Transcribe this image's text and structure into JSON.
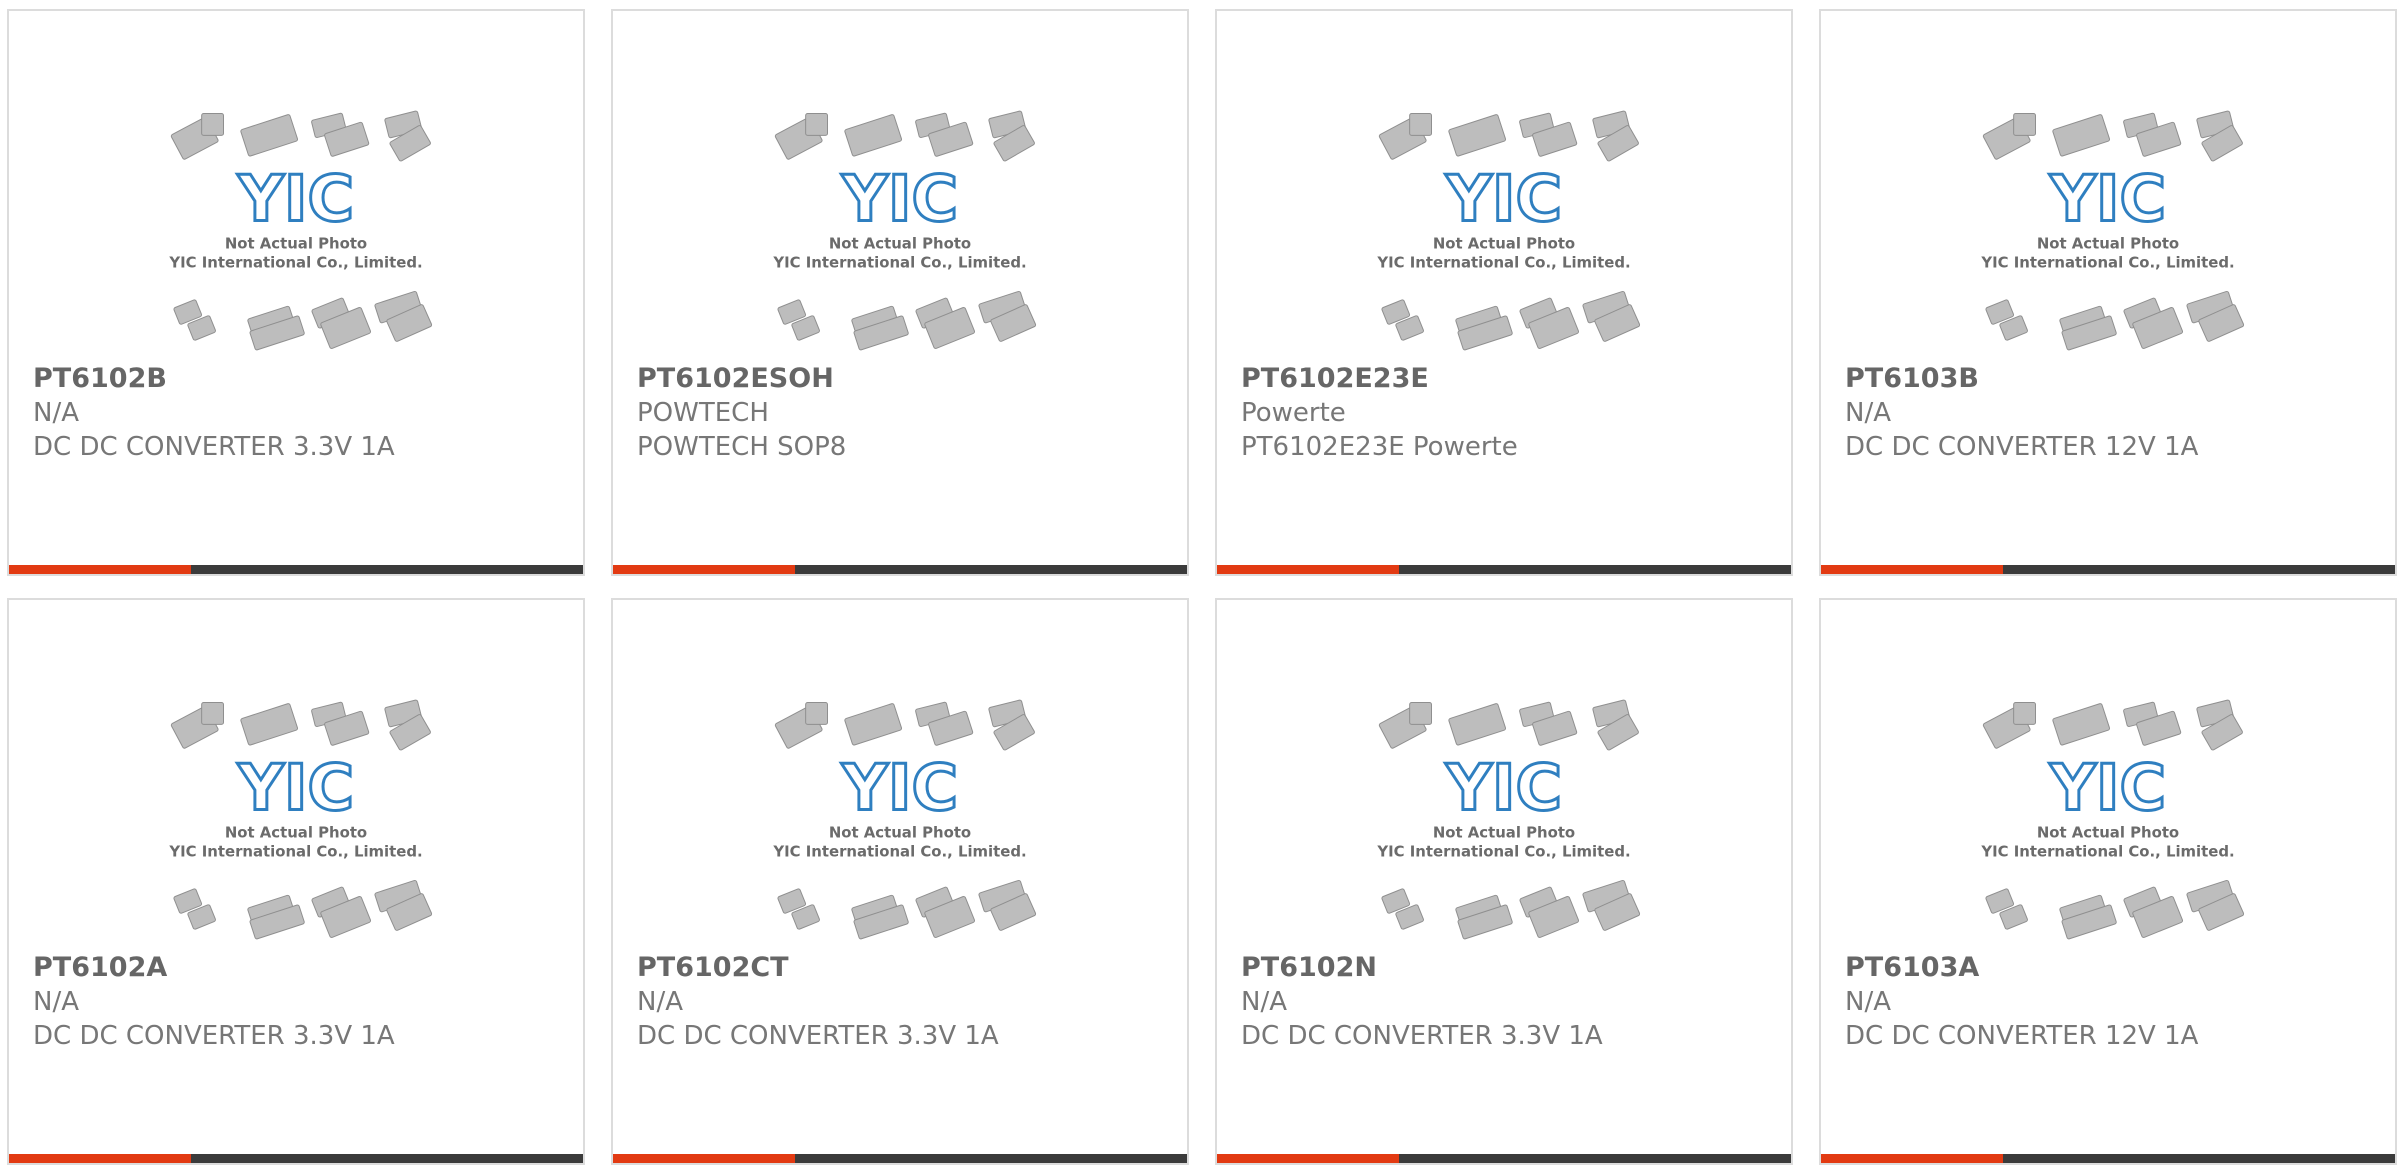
{
  "image_overlay": {
    "line1": "Not Actual Photo",
    "line2": "YIC International Co., Limited.",
    "logo_text": "YIC"
  },
  "colors": {
    "accent": "#e23a12",
    "bar_dark": "#3b3b3b",
    "text": "#6b6b6b",
    "logo_blue": "#2f7fc0"
  },
  "products": [
    {
      "part": "PT6102B",
      "manufacturer": "N/A",
      "description": "DC DC CONVERTER 3.3V 1A"
    },
    {
      "part": "PT6102ESOH",
      "manufacturer": "POWTECH",
      "description": "POWTECH SOP8"
    },
    {
      "part": "PT6102E23E",
      "manufacturer": "Powerte",
      "description": "PT6102E23E Powerte"
    },
    {
      "part": "PT6103B",
      "manufacturer": "N/A",
      "description": "DC DC CONVERTER 12V 1A"
    },
    {
      "part": "PT6102A",
      "manufacturer": "N/A",
      "description": "DC DC CONVERTER 3.3V 1A"
    },
    {
      "part": "PT6102CT",
      "manufacturer": "N/A",
      "description": "DC DC CONVERTER 3.3V 1A"
    },
    {
      "part": "PT6102N",
      "manufacturer": "N/A",
      "description": "DC DC CONVERTER 3.3V 1A"
    },
    {
      "part": "PT6103A",
      "manufacturer": "N/A",
      "description": "DC DC CONVERTER 12V 1A"
    }
  ]
}
